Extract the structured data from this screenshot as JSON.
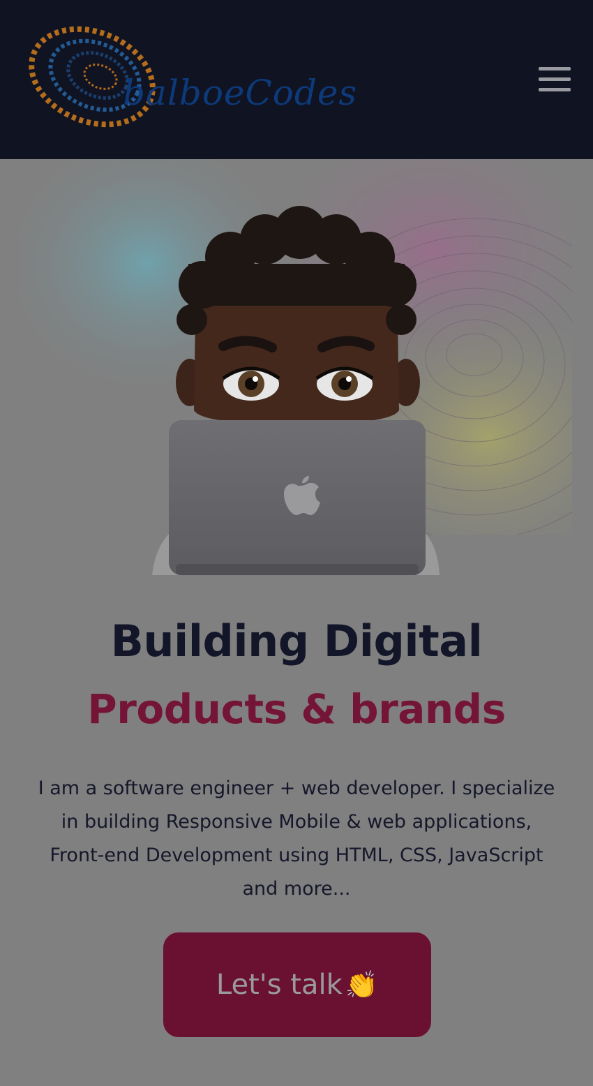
{
  "header": {
    "logo_text": "balboeCodes",
    "logo_ring_text": "01010101010101",
    "menu_icon": "hamburger-menu-icon"
  },
  "hero": {
    "illustration": "memoji-with-laptop",
    "laptop_logo_icon": "apple-logo-icon"
  },
  "main": {
    "headline": "Building Digital",
    "subheadline": "Products & brands",
    "description": "I am a software engineer + web developer. I specialize in building Responsive Mobile & web applications, Front-end Development using HTML, CSS, JavaScript and more...",
    "cta_label": "Let's talk",
    "cta_emoji": "👏"
  },
  "colors": {
    "header_bg": "#101322",
    "page_bg": "#808080",
    "headline": "#131628",
    "accent": "#741538",
    "cta_bg": "#6a1030"
  }
}
